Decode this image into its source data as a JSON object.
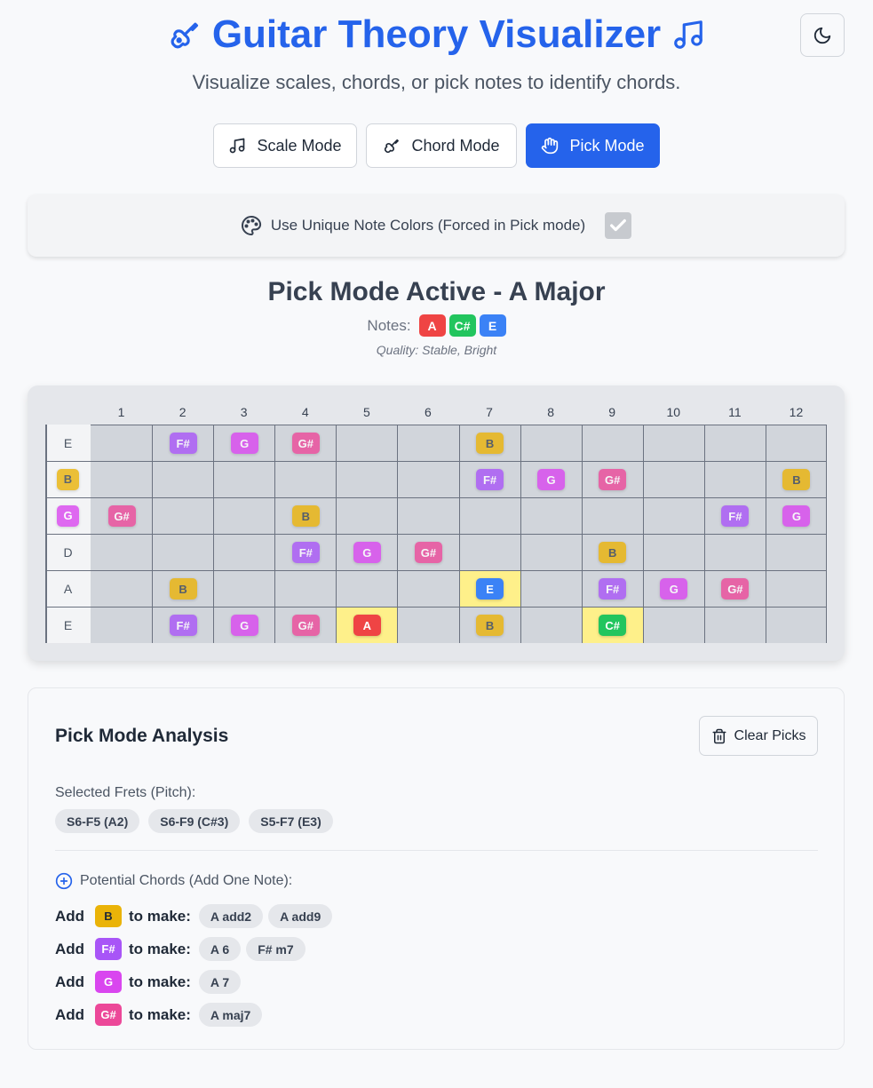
{
  "header": {
    "title": "Guitar Theory Visualizer",
    "subtitle": "Visualize scales, chords, or pick notes to identify chords.",
    "theme_toggle_icon": "moon-icon"
  },
  "modes": [
    {
      "label": "Scale Mode",
      "icon": "music-note-icon",
      "active": false
    },
    {
      "label": "Chord Mode",
      "icon": "guitar-icon",
      "active": false
    },
    {
      "label": "Pick Mode",
      "icon": "hand-icon",
      "active": true
    }
  ],
  "color_option": {
    "label": "Use Unique Note Colors (Forced in Pick mode)",
    "checked": true
  },
  "chord_info": {
    "title": "Pick Mode Active - A Major",
    "notes_label": "Notes:",
    "notes": [
      "A",
      "C#",
      "E"
    ],
    "quality": "Quality: Stable, Bright"
  },
  "note_colors": {
    "A": "#ef4444",
    "C#": "#22c55e",
    "E": "#3b82f6",
    "B": "#eab308",
    "F#": "#a855f7",
    "G": "#d946ef",
    "G#": "#ec4899"
  },
  "fretboard": {
    "fret_numbers": [
      "1",
      "2",
      "3",
      "4",
      "5",
      "6",
      "7",
      "8",
      "9",
      "10",
      "11",
      "12"
    ],
    "strings": [
      {
        "open": "E",
        "open_badge": false,
        "notes": [
          "",
          "F#",
          "G",
          "G#",
          "",
          "",
          "B",
          "",
          "",
          "",
          "",
          ""
        ]
      },
      {
        "open": "B",
        "open_badge": true,
        "notes": [
          "",
          "",
          "",
          "",
          "",
          "",
          "F#",
          "G",
          "G#",
          "",
          "",
          "B"
        ]
      },
      {
        "open": "G",
        "open_badge": true,
        "notes": [
          "G#",
          "",
          "",
          "B",
          "",
          "",
          "",
          "",
          "",
          "",
          "F#",
          "G"
        ]
      },
      {
        "open": "D",
        "open_badge": false,
        "notes": [
          "",
          "",
          "",
          "F#",
          "G",
          "G#",
          "",
          "",
          "B",
          "",
          "",
          ""
        ]
      },
      {
        "open": "A",
        "open_badge": false,
        "notes": [
          "",
          "B",
          "",
          "",
          "",
          "",
          "E",
          "",
          "F#",
          "G",
          "G#",
          ""
        ]
      },
      {
        "open": "E",
        "open_badge": false,
        "notes": [
          "",
          "F#",
          "G",
          "G#",
          "A",
          "",
          "B",
          "",
          "C#",
          "",
          "",
          ""
        ]
      }
    ],
    "picked": [
      [
        4,
        7
      ],
      [
        5,
        5
      ],
      [
        5,
        9
      ]
    ]
  },
  "analysis": {
    "title": "Pick Mode Analysis",
    "clear_label": "Clear Picks",
    "selected_label": "Selected Frets (Pitch):",
    "selected": [
      "S6-F5 (A2)",
      "S6-F9 (C#3)",
      "S5-F7 (E3)"
    ],
    "potential_label": "Potential Chords (Add One Note):",
    "add_word": "Add",
    "make_word": "to make:",
    "potential": [
      {
        "note": "B",
        "chords": [
          "A add2",
          "A add9"
        ]
      },
      {
        "note": "F#",
        "chords": [
          "A 6",
          "F# m7"
        ]
      },
      {
        "note": "G",
        "chords": [
          "A 7"
        ]
      },
      {
        "note": "G#",
        "chords": [
          "A maj7"
        ]
      }
    ]
  }
}
